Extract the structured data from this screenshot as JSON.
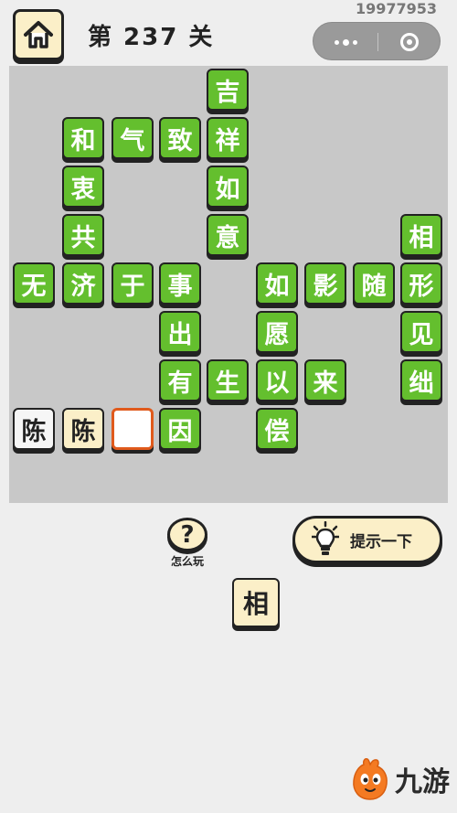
{
  "header": {
    "level_text": "第 237 关",
    "user_id": "19977953"
  },
  "capsule": {
    "more_icon": "more-dots-icon",
    "close_icon": "target-ring-icon"
  },
  "board": {
    "row_0": [
      "吉"
    ],
    "row_1": [
      "和",
      "气",
      "致",
      "祥"
    ],
    "row_2": [
      "衷",
      "如"
    ],
    "row_3": [
      "共",
      "意",
      "相"
    ],
    "row_4": [
      "无",
      "济",
      "于",
      "事",
      "如",
      "影",
      "随",
      "形"
    ],
    "row_5": [
      "出",
      "愿",
      "见"
    ],
    "row_6": [
      "有",
      "生",
      "以",
      "来",
      "绌"
    ],
    "row_7": [
      "陈",
      "陈",
      "",
      "因",
      "偿"
    ]
  },
  "controls": {
    "help_symbol": "?",
    "help_label": "怎么玩",
    "hint_label": "提示一下",
    "hint_icon": "lightbulb-icon"
  },
  "answer_tile": "相",
  "watermark": {
    "text": "九游",
    "icon": "mascot-icon"
  },
  "colors": {
    "tile_green": "#64bf2e",
    "tile_cream": "#fbefc8",
    "board_bg": "#c8c8c8",
    "selected_border": "#e05a1c"
  }
}
